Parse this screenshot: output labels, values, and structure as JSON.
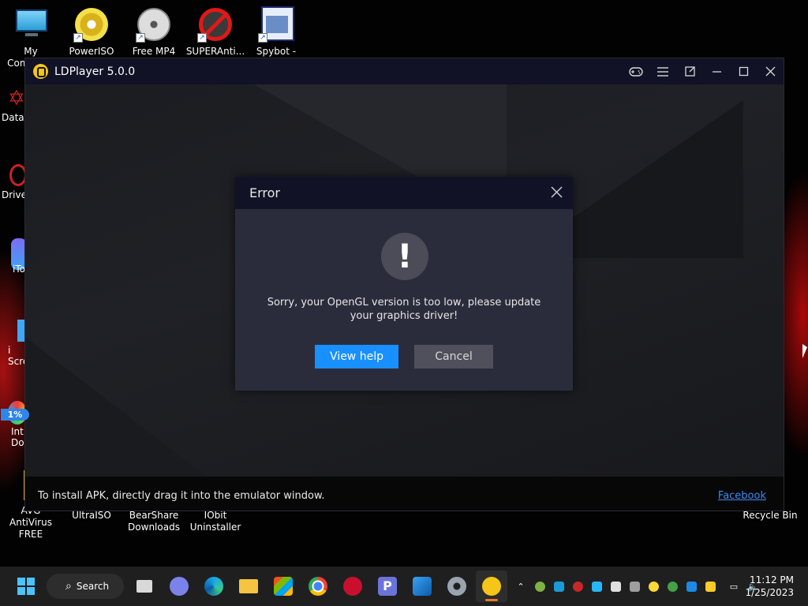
{
  "desktop": {
    "top_icons": [
      {
        "label": "My Computer",
        "icon": "monitor-icon"
      },
      {
        "label": "PowerISO",
        "icon": "disc-icon"
      },
      {
        "label": "Free MP4",
        "icon": "film-reel-icon"
      },
      {
        "label": "SUPERAnti...",
        "icon": "no-bug-icon"
      },
      {
        "label": "Spybot -",
        "icon": "spybot-icon"
      }
    ],
    "side_icons": [
      {
        "label": "DataV",
        "icon": "pentagram-icon"
      },
      {
        "label": "Drive",
        "icon": "driver-icon"
      },
      {
        "label": "iTo",
        "icon": "itools-icon"
      },
      {
        "label": "i Scre",
        "icon": "screen-icon"
      },
      {
        "label": "Int Do",
        "icon": "idm-icon"
      }
    ],
    "bottom_icons": [
      {
        "label": "AVG AntiVirus FREE",
        "icon": "avg-icon"
      },
      {
        "label": "UltraISO",
        "icon": "ultraiso-icon"
      },
      {
        "label": "BearShare Downloads",
        "icon": "bearshare-icon"
      },
      {
        "label": "IObit Uninstaller",
        "icon": "iobit-icon"
      },
      {
        "label": "Recycle Bin",
        "icon": "recycle-bin-icon"
      }
    ]
  },
  "ldplayer": {
    "title": "LDPlayer 5.0.0",
    "bottom_tip": "To install APK, directly drag it into the emulator window.",
    "facebook_link": "Facebook",
    "progress_label": "1%",
    "progress_value": 0.01
  },
  "dialog": {
    "title": "Error",
    "icon": "exclamation-icon",
    "message": "Sorry, your OpenGL version is too low, please update your graphics driver!",
    "primary_button": "View help",
    "secondary_button": "Cancel"
  },
  "taskbar": {
    "search_label": "Search",
    "time": "11:12 PM",
    "date": "1/25/2023"
  },
  "colors": {
    "accent_blue": "#1890ff",
    "title_bar": "#111226",
    "dialog_bg": "#2b2c3b",
    "ld_yellow": "#f5c518"
  }
}
